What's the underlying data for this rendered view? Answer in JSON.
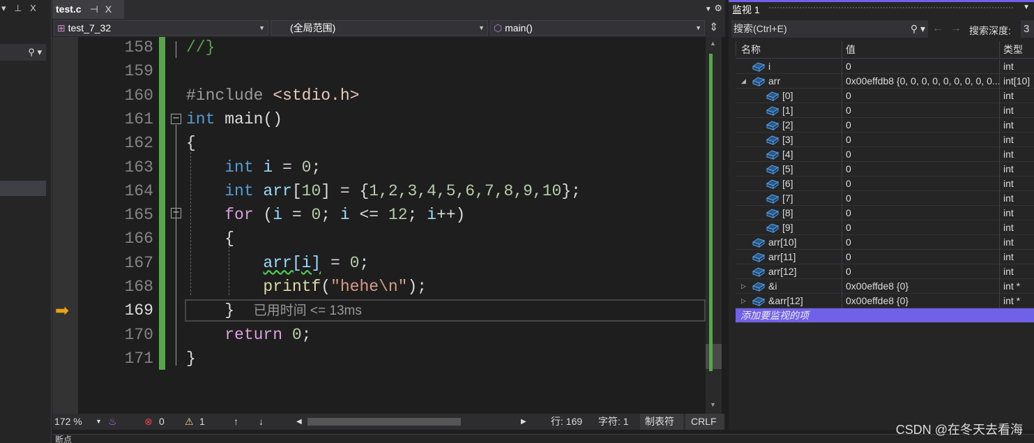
{
  "left_panel": {
    "header_icons": [
      "dropdown-icon",
      "pin-icon",
      "close-icon"
    ],
    "search_icon": "search-icon"
  },
  "tab": {
    "label": "test.c",
    "pin": "⊣",
    "close": "X"
  },
  "nav": {
    "project": "test_7_32",
    "scope": "(全局范围)",
    "function": "main()"
  },
  "code_lines": [
    {
      "n": "158"
    },
    {
      "n": "159"
    },
    {
      "n": "160"
    },
    {
      "n": "161"
    },
    {
      "n": "162"
    },
    {
      "n": "163"
    },
    {
      "n": "164"
    },
    {
      "n": "165"
    },
    {
      "n": "166"
    },
    {
      "n": "167"
    },
    {
      "n": "168"
    },
    {
      "n": "169"
    },
    {
      "n": "170"
    },
    {
      "n": "171"
    }
  ],
  "code": {
    "l158": "//}",
    "l160a": "#include ",
    "l160b": "<stdio.h>",
    "l161a": "int",
    "l161b": " main()",
    "l162": "{",
    "l163a": "    int",
    "l163b": " i",
    "l163c": " = ",
    "l163d": "0",
    "l163e": ";",
    "l164a": "    int",
    "l164b": " arr",
    "l164c": "[",
    "l164d": "10",
    "l164e": "] = {",
    "l164f": "1,2,3,4,5,6,7,8,9,10",
    "l164g": "};",
    "l165a": "    for",
    "l165b": " (",
    "l165c": "i",
    "l165d": " = ",
    "l165e": "0",
    "l165f": "; ",
    "l165g": "i",
    "l165h": " <= ",
    "l165i": "12",
    "l165j": "; ",
    "l165k": "i",
    "l165l": "++)",
    "l166": "    {",
    "l167a": "        ",
    "l167b": "arr[i]",
    "l167c": " = ",
    "l167d": "0",
    "l167e": ";",
    "l168a": "        ",
    "l168b": "printf",
    "l168c": "(",
    "l168d": "\"hehe\\n\"",
    "l168e": ");",
    "l169a": "    }",
    "l169b": "已用时间 <= 13ms",
    "l170a": "    return",
    "l170b": " ",
    "l170c": "0",
    "l170d": ";",
    "l171": "}"
  },
  "current_line": "169",
  "status": {
    "zoom": "172 %",
    "errors": "0",
    "warnings": "1",
    "line": "行: 169",
    "char": "字符: 1",
    "tabs": "制表符",
    "eol": "CRLF"
  },
  "watch": {
    "title": "监视 1",
    "search_placeholder": "搜索(Ctrl+E)",
    "depth_label": "搜索深度:",
    "depth": "3",
    "columns": [
      "名称",
      "值",
      "类型"
    ],
    "rows": [
      {
        "name": "i",
        "value": "0",
        "type": "int",
        "level": 0,
        "expander": ""
      },
      {
        "name": "arr",
        "value": "0x00effdb8 {0, 0, 0, 0, 0, 0, 0, 0, 0...",
        "type": "int[10]",
        "level": 0,
        "expander": "◢"
      },
      {
        "name": "[0]",
        "value": "0",
        "type": "int",
        "level": 1,
        "expander": ""
      },
      {
        "name": "[1]",
        "value": "0",
        "type": "int",
        "level": 1,
        "expander": ""
      },
      {
        "name": "[2]",
        "value": "0",
        "type": "int",
        "level": 1,
        "expander": ""
      },
      {
        "name": "[3]",
        "value": "0",
        "type": "int",
        "level": 1,
        "expander": ""
      },
      {
        "name": "[4]",
        "value": "0",
        "type": "int",
        "level": 1,
        "expander": ""
      },
      {
        "name": "[5]",
        "value": "0",
        "type": "int",
        "level": 1,
        "expander": ""
      },
      {
        "name": "[6]",
        "value": "0",
        "type": "int",
        "level": 1,
        "expander": ""
      },
      {
        "name": "[7]",
        "value": "0",
        "type": "int",
        "level": 1,
        "expander": ""
      },
      {
        "name": "[8]",
        "value": "0",
        "type": "int",
        "level": 1,
        "expander": ""
      },
      {
        "name": "[9]",
        "value": "0",
        "type": "int",
        "level": 1,
        "expander": ""
      },
      {
        "name": "arr[10]",
        "value": "0",
        "type": "int",
        "level": 0,
        "expander": ""
      },
      {
        "name": "arr[11]",
        "value": "0",
        "type": "int",
        "level": 0,
        "expander": ""
      },
      {
        "name": "arr[12]",
        "value": "0",
        "type": "int",
        "level": 0,
        "expander": ""
      },
      {
        "name": "&i",
        "value": "0x00effde8 {0}",
        "type": "int *",
        "level": 0,
        "expander": "▷"
      },
      {
        "name": "&arr[12]",
        "value": "0x00effde8 {0}",
        "type": "int *",
        "level": 0,
        "expander": "▷"
      }
    ],
    "add_item": "添加要监视的项"
  },
  "bottom_panel": {
    "label": "断点"
  },
  "watermark": "CSDN @在冬天去看海",
  "colors": {
    "accent": "#7160e8",
    "change_bar": "#57a64a",
    "keyword": "#569cd6",
    "control": "#d8a0df",
    "variable": "#9cdcfe",
    "number": "#b5cea8",
    "string": "#d69d85",
    "function": "#dcdcaa"
  }
}
